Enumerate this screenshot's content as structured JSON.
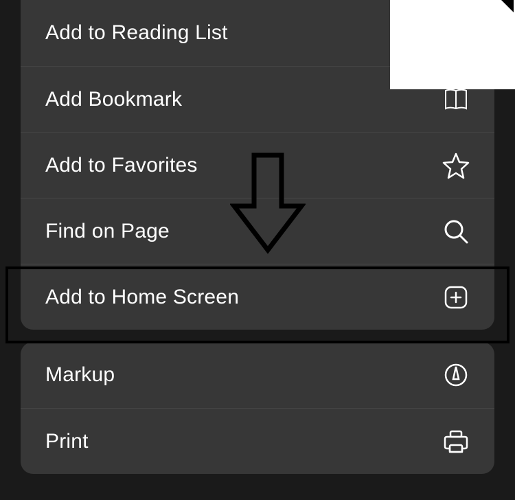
{
  "group1": {
    "items": [
      {
        "label": "Add to Reading List",
        "icon": ""
      },
      {
        "label": "Add Bookmark",
        "icon": "book"
      },
      {
        "label": "Add to Favorites",
        "icon": "star"
      },
      {
        "label": "Find on Page",
        "icon": "search"
      },
      {
        "label": "Add to Home Screen",
        "icon": "plus-square"
      }
    ]
  },
  "group2": {
    "items": [
      {
        "label": "Markup",
        "icon": "markup"
      },
      {
        "label": "Print",
        "icon": "print"
      }
    ]
  }
}
